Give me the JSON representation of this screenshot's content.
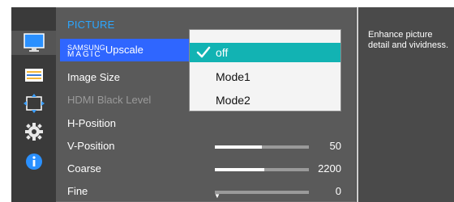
{
  "nav": {
    "icons": [
      {
        "name": "picture-icon",
        "color": "#2a90ff"
      },
      {
        "name": "screen-adjust-icon",
        "color": "#f3b83b"
      },
      {
        "name": "position-icon",
        "color": "#3ba0ff"
      },
      {
        "name": "gear-icon",
        "color": "#ffffff"
      },
      {
        "name": "info-icon",
        "color": "#2a90ff"
      }
    ]
  },
  "menu": {
    "title": "PICTURE",
    "title_color": "#2ba6ff",
    "items": [
      {
        "id": "magic-upscale",
        "prefix_small": "SAMSUNG",
        "prefix_big": "MAGIC",
        "label": "Upscale"
      },
      {
        "id": "image-size",
        "label": "Image Size"
      },
      {
        "id": "hdmi-black-level",
        "label": "HDMI Black Level"
      },
      {
        "id": "h-position",
        "label": "H-Position"
      },
      {
        "id": "v-position",
        "label": "V-Position",
        "value": "50",
        "level": 0.5
      },
      {
        "id": "coarse",
        "label": "Coarse",
        "value": "2200",
        "level": 0.53
      },
      {
        "id": "fine",
        "label": "Fine",
        "value": "0",
        "level": 0.0
      }
    ]
  },
  "dropdown": {
    "options": [
      "off",
      "Mode1",
      "Mode2"
    ],
    "selected": "off",
    "selected_color": "#12b3b3"
  },
  "help": {
    "text": "Enhance picture detail and vividness."
  }
}
